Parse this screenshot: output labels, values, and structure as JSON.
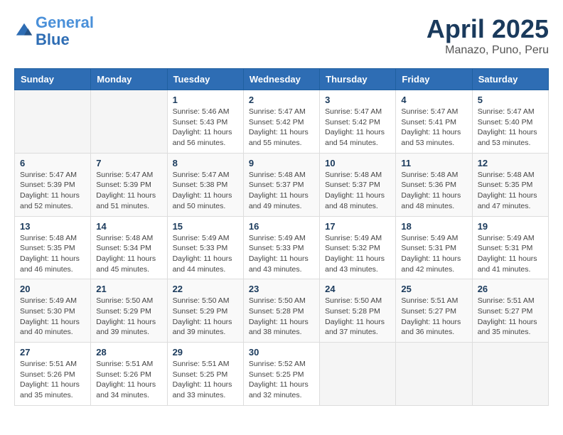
{
  "logo": {
    "line1": "General",
    "line2": "Blue"
  },
  "title": "April 2025",
  "subtitle": "Manazo, Puno, Peru",
  "headers": [
    "Sunday",
    "Monday",
    "Tuesday",
    "Wednesday",
    "Thursday",
    "Friday",
    "Saturday"
  ],
  "weeks": [
    [
      {
        "day": "",
        "sunrise": "",
        "sunset": "",
        "daylight": ""
      },
      {
        "day": "",
        "sunrise": "",
        "sunset": "",
        "daylight": ""
      },
      {
        "day": "1",
        "sunrise": "Sunrise: 5:46 AM",
        "sunset": "Sunset: 5:43 PM",
        "daylight": "Daylight: 11 hours and 56 minutes."
      },
      {
        "day": "2",
        "sunrise": "Sunrise: 5:47 AM",
        "sunset": "Sunset: 5:42 PM",
        "daylight": "Daylight: 11 hours and 55 minutes."
      },
      {
        "day": "3",
        "sunrise": "Sunrise: 5:47 AM",
        "sunset": "Sunset: 5:42 PM",
        "daylight": "Daylight: 11 hours and 54 minutes."
      },
      {
        "day": "4",
        "sunrise": "Sunrise: 5:47 AM",
        "sunset": "Sunset: 5:41 PM",
        "daylight": "Daylight: 11 hours and 53 minutes."
      },
      {
        "day": "5",
        "sunrise": "Sunrise: 5:47 AM",
        "sunset": "Sunset: 5:40 PM",
        "daylight": "Daylight: 11 hours and 53 minutes."
      }
    ],
    [
      {
        "day": "6",
        "sunrise": "Sunrise: 5:47 AM",
        "sunset": "Sunset: 5:39 PM",
        "daylight": "Daylight: 11 hours and 52 minutes."
      },
      {
        "day": "7",
        "sunrise": "Sunrise: 5:47 AM",
        "sunset": "Sunset: 5:39 PM",
        "daylight": "Daylight: 11 hours and 51 minutes."
      },
      {
        "day": "8",
        "sunrise": "Sunrise: 5:47 AM",
        "sunset": "Sunset: 5:38 PM",
        "daylight": "Daylight: 11 hours and 50 minutes."
      },
      {
        "day": "9",
        "sunrise": "Sunrise: 5:48 AM",
        "sunset": "Sunset: 5:37 PM",
        "daylight": "Daylight: 11 hours and 49 minutes."
      },
      {
        "day": "10",
        "sunrise": "Sunrise: 5:48 AM",
        "sunset": "Sunset: 5:37 PM",
        "daylight": "Daylight: 11 hours and 48 minutes."
      },
      {
        "day": "11",
        "sunrise": "Sunrise: 5:48 AM",
        "sunset": "Sunset: 5:36 PM",
        "daylight": "Daylight: 11 hours and 48 minutes."
      },
      {
        "day": "12",
        "sunrise": "Sunrise: 5:48 AM",
        "sunset": "Sunset: 5:35 PM",
        "daylight": "Daylight: 11 hours and 47 minutes."
      }
    ],
    [
      {
        "day": "13",
        "sunrise": "Sunrise: 5:48 AM",
        "sunset": "Sunset: 5:35 PM",
        "daylight": "Daylight: 11 hours and 46 minutes."
      },
      {
        "day": "14",
        "sunrise": "Sunrise: 5:48 AM",
        "sunset": "Sunset: 5:34 PM",
        "daylight": "Daylight: 11 hours and 45 minutes."
      },
      {
        "day": "15",
        "sunrise": "Sunrise: 5:49 AM",
        "sunset": "Sunset: 5:33 PM",
        "daylight": "Daylight: 11 hours and 44 minutes."
      },
      {
        "day": "16",
        "sunrise": "Sunrise: 5:49 AM",
        "sunset": "Sunset: 5:33 PM",
        "daylight": "Daylight: 11 hours and 43 minutes."
      },
      {
        "day": "17",
        "sunrise": "Sunrise: 5:49 AM",
        "sunset": "Sunset: 5:32 PM",
        "daylight": "Daylight: 11 hours and 43 minutes."
      },
      {
        "day": "18",
        "sunrise": "Sunrise: 5:49 AM",
        "sunset": "Sunset: 5:31 PM",
        "daylight": "Daylight: 11 hours and 42 minutes."
      },
      {
        "day": "19",
        "sunrise": "Sunrise: 5:49 AM",
        "sunset": "Sunset: 5:31 PM",
        "daylight": "Daylight: 11 hours and 41 minutes."
      }
    ],
    [
      {
        "day": "20",
        "sunrise": "Sunrise: 5:49 AM",
        "sunset": "Sunset: 5:30 PM",
        "daylight": "Daylight: 11 hours and 40 minutes."
      },
      {
        "day": "21",
        "sunrise": "Sunrise: 5:50 AM",
        "sunset": "Sunset: 5:29 PM",
        "daylight": "Daylight: 11 hours and 39 minutes."
      },
      {
        "day": "22",
        "sunrise": "Sunrise: 5:50 AM",
        "sunset": "Sunset: 5:29 PM",
        "daylight": "Daylight: 11 hours and 39 minutes."
      },
      {
        "day": "23",
        "sunrise": "Sunrise: 5:50 AM",
        "sunset": "Sunset: 5:28 PM",
        "daylight": "Daylight: 11 hours and 38 minutes."
      },
      {
        "day": "24",
        "sunrise": "Sunrise: 5:50 AM",
        "sunset": "Sunset: 5:28 PM",
        "daylight": "Daylight: 11 hours and 37 minutes."
      },
      {
        "day": "25",
        "sunrise": "Sunrise: 5:51 AM",
        "sunset": "Sunset: 5:27 PM",
        "daylight": "Daylight: 11 hours and 36 minutes."
      },
      {
        "day": "26",
        "sunrise": "Sunrise: 5:51 AM",
        "sunset": "Sunset: 5:27 PM",
        "daylight": "Daylight: 11 hours and 35 minutes."
      }
    ],
    [
      {
        "day": "27",
        "sunrise": "Sunrise: 5:51 AM",
        "sunset": "Sunset: 5:26 PM",
        "daylight": "Daylight: 11 hours and 35 minutes."
      },
      {
        "day": "28",
        "sunrise": "Sunrise: 5:51 AM",
        "sunset": "Sunset: 5:26 PM",
        "daylight": "Daylight: 11 hours and 34 minutes."
      },
      {
        "day": "29",
        "sunrise": "Sunrise: 5:51 AM",
        "sunset": "Sunset: 5:25 PM",
        "daylight": "Daylight: 11 hours and 33 minutes."
      },
      {
        "day": "30",
        "sunrise": "Sunrise: 5:52 AM",
        "sunset": "Sunset: 5:25 PM",
        "daylight": "Daylight: 11 hours and 32 minutes."
      },
      {
        "day": "",
        "sunrise": "",
        "sunset": "",
        "daylight": ""
      },
      {
        "day": "",
        "sunrise": "",
        "sunset": "",
        "daylight": ""
      },
      {
        "day": "",
        "sunrise": "",
        "sunset": "",
        "daylight": ""
      }
    ]
  ]
}
